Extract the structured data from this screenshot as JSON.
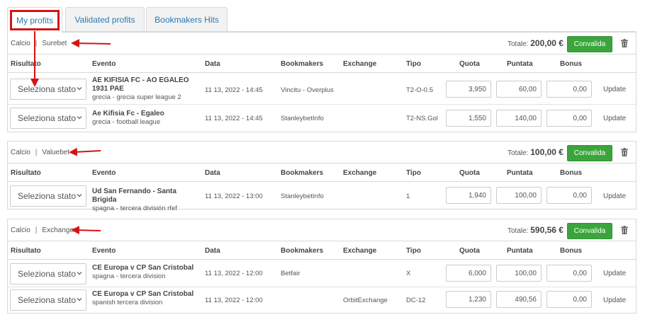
{
  "tabs": [
    {
      "label": "My profits"
    },
    {
      "label": "Validated profits"
    },
    {
      "label": "Bookmakers Hits"
    }
  ],
  "columns": {
    "risultato": "Risultato",
    "evento": "Evento",
    "data": "Data",
    "bookmakers": "Bookmakers",
    "exchange": "Exchange",
    "tipo": "Tipo",
    "quota": "Quota",
    "puntata": "Puntata",
    "bonus": "Bonus"
  },
  "totale_label": "Totale:",
  "convalida_label": "Convalida",
  "select_label": "Seleziona stato",
  "update_label": "Update",
  "sections": [
    {
      "sport": "Calcio",
      "kind": "Surebet",
      "total": "200,00 €",
      "rows": [
        {
          "event": "AE KIFISIA FC - AO EGALEO 1931 PAE",
          "league": "grecia - grecia super league 2",
          "date": "11 13, 2022 - 14:45",
          "bookmaker": "Vincitu - Overplus",
          "exchange": "",
          "tipo": "T2-O-0.5",
          "quota": "3,950",
          "puntata": "60,00",
          "bonus": "0,00"
        },
        {
          "event": "Ae Kifisia Fc - Egaleo",
          "league": "grecia - football league",
          "date": "11 13, 2022 - 14:45",
          "bookmaker": "StanleybetInfo",
          "exchange": "",
          "tipo": "T2-NS.Gol",
          "quota": "1,550",
          "puntata": "140,00",
          "bonus": "0,00"
        }
      ]
    },
    {
      "sport": "Calcio",
      "kind": "Valuebet",
      "total": "100,00 €",
      "rows": [
        {
          "event": "Ud San Fernando - Santa Brigida",
          "league": "spagna - tercera división rfef",
          "date": "11 13, 2022 - 13:00",
          "bookmaker": "StanleybetInfo",
          "exchange": "",
          "tipo": "1",
          "quota": "1,940",
          "puntata": "100,00",
          "bonus": "0,00"
        }
      ]
    },
    {
      "sport": "Calcio",
      "kind": "Exchange",
      "total": "590,56 €",
      "rows": [
        {
          "event": "CE Europa v CP San Cristobal",
          "league": "spagna - tercera division",
          "date": "11 13, 2022 - 12:00",
          "bookmaker": "Betfair",
          "exchange": "",
          "tipo": "X",
          "quota": "6,000",
          "puntata": "100,00",
          "bonus": "0,00"
        },
        {
          "event": "CE Europa v CP San Cristobal",
          "league": "spanish tercera division",
          "date": "11 13, 2022 - 12:00",
          "bookmaker": "",
          "exchange": "OrbitExchange",
          "tipo": "DC-12",
          "quota": "1,230",
          "puntata": "490,56",
          "bonus": "0,00"
        }
      ]
    }
  ],
  "colors": {
    "accent_green": "#3ba53b",
    "tab_text": "#2a7ab0",
    "annotation_red": "#d41414"
  },
  "icons": {
    "trash": "trash-icon",
    "chevron": "chevron-down-icon"
  }
}
